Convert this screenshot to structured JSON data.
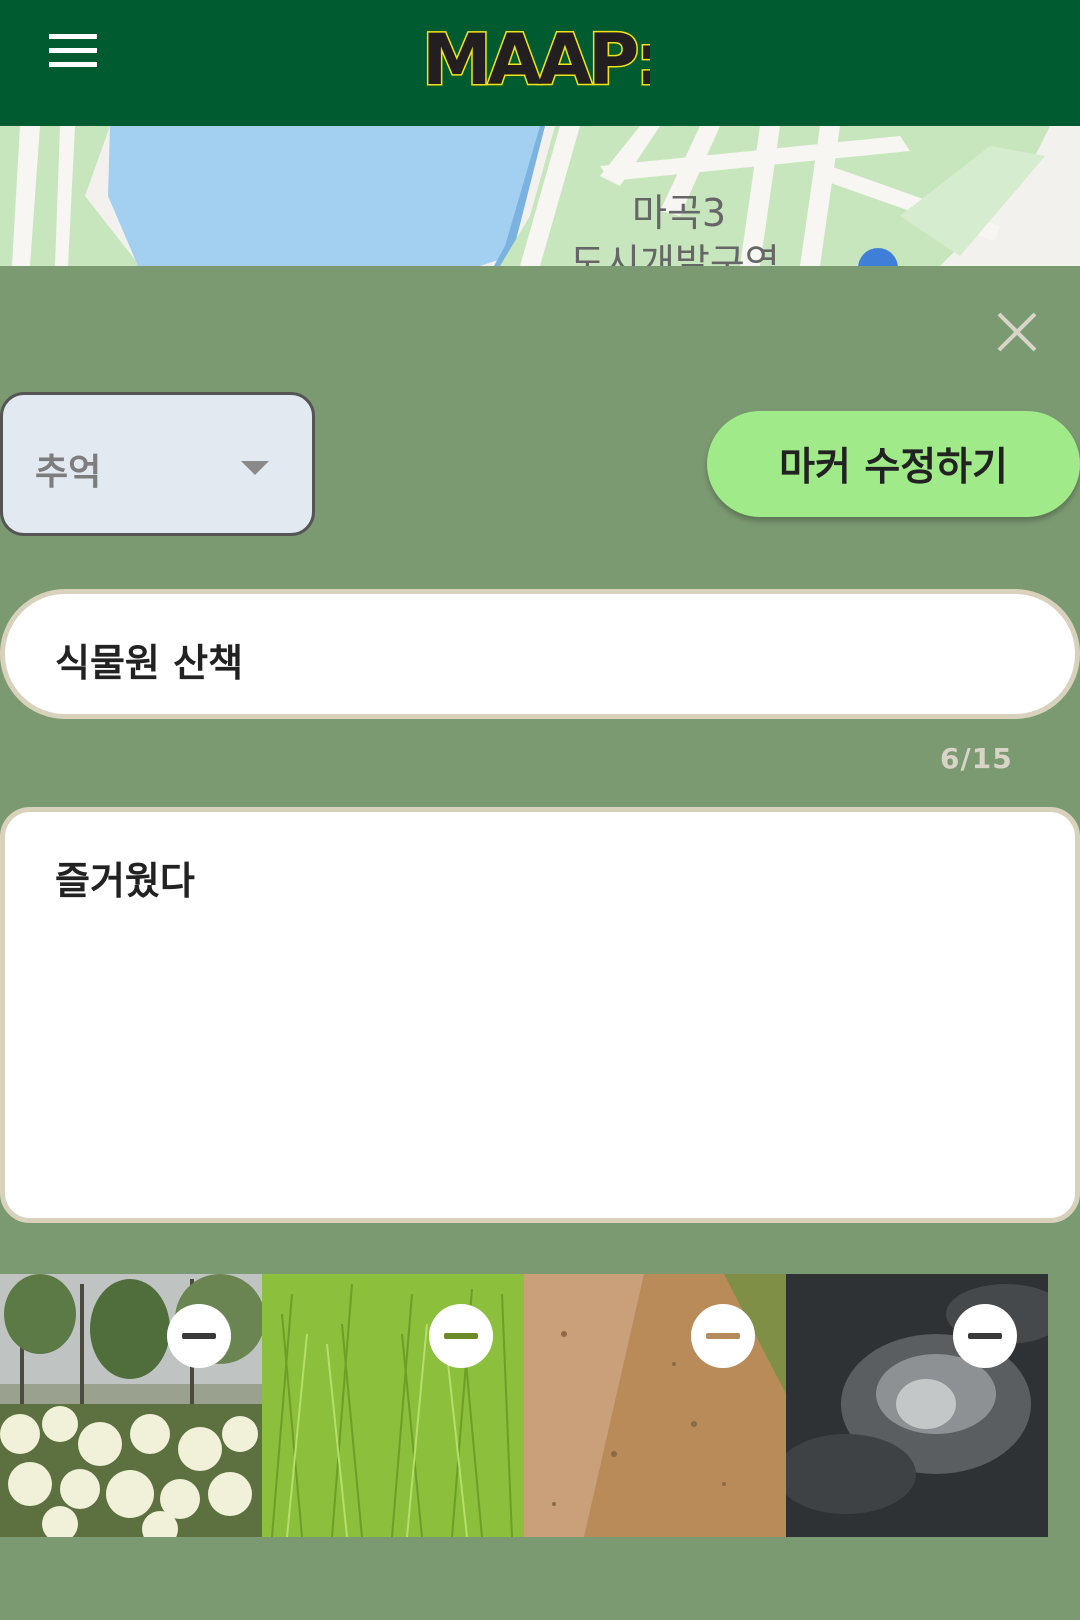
{
  "header": {
    "menu_icon": "hamburger-menu-icon",
    "logo_text": "MAAP:"
  },
  "map": {
    "place_label_line1": "마곡3",
    "place_label_line2": "도시개발구역"
  },
  "form": {
    "close_icon": "close-icon",
    "category": {
      "selected": "추억",
      "icon": "caret-down-icon"
    },
    "submit_label": "마커 수정하기",
    "title_value": "식물원 산책",
    "title_counter": "6/15",
    "body_value": "즐거웠다"
  },
  "photos": [
    {
      "subject": "white hydrangea bushes under trees",
      "remove_icon": "minus-circle-icon"
    },
    {
      "subject": "green grass",
      "remove_icon": "minus-circle-icon"
    },
    {
      "subject": "dirt path",
      "remove_icon": "minus-circle-icon"
    },
    {
      "subject": "dark cloudy sky",
      "remove_icon": "minus-circle-icon"
    }
  ],
  "colors": {
    "header_bg": "#005c30",
    "panel_bg": "#7c9a72",
    "submit_bg": "#a0ea8a",
    "select_bg": "#e2e9f1",
    "logo_yellow": "#f3e217"
  }
}
